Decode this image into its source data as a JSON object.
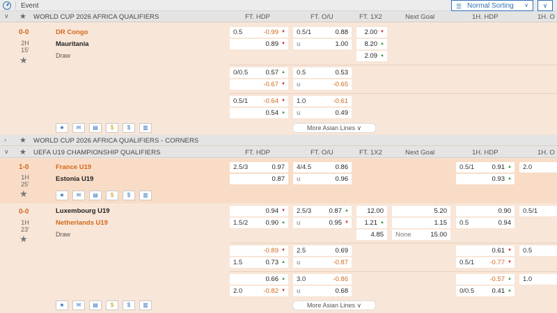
{
  "topbar": {
    "event_label": "Event",
    "sort_label": "Normal Sorting",
    "sort_caret": "∨",
    "collapse": "∨"
  },
  "headers": {
    "ft_hdp": "FT. HDP",
    "ft_ou": "FT. O/U",
    "ft_1x2": "FT. 1X2",
    "next_goal": "Next Goal",
    "h1_hdp": "1H. HDP",
    "h1_ou": "1H. O"
  },
  "leagues": [
    {
      "name": "WORLD CUP 2026 AFRICA QUALIFIERS",
      "chev": "∨"
    },
    {
      "name": "WORLD CUP 2026 AFRICA QUALIFIERS - CORNERS",
      "chev": "›"
    },
    {
      "name": "UEFA U19 CHAMPIONSHIP QUALIFIERS",
      "chev": "∨"
    }
  ],
  "m1": {
    "score": "0-0",
    "half": "2H",
    "minute": "15'",
    "home": "DR Congo",
    "away": "Mauritania",
    "draw": "Draw",
    "r1": {
      "hdp_l": "0.5",
      "hdp_home": "-0.99",
      "hdp_away": "0.89",
      "ou_l": "0.5/1",
      "ou_over": "0.88",
      "ou_u": "u",
      "ou_under": "1.00",
      "x_home": "2.00",
      "x_away": "8.20",
      "x_draw": "2.09"
    },
    "r2": {
      "hdp_l": "0/0.5",
      "hdp_home": "0.57",
      "hdp_away": "-0.67",
      "ou_l": "0.5",
      "ou_over": "0.53",
      "ou_u": "u",
      "ou_under": "-0.65"
    },
    "r3": {
      "hdp_l": "0.5/1",
      "hdp_home": "-0.64",
      "hdp_away": "0.54",
      "ou_l": "1.0",
      "ou_over": "-0.61",
      "ou_u": "u",
      "ou_under": "0.49"
    },
    "more": "More Asian Lines ∨"
  },
  "m2": {
    "score": "1-0",
    "half": "1H",
    "minute": "25'",
    "home": "France U19",
    "away": "Estonia U19",
    "hdp_l": "2.5/3",
    "hdp_home": "0.97",
    "hdp_away": "0.87",
    "ou_l": "4/4.5",
    "ou_over": "0.86",
    "ou_u": "u",
    "ou_under": "0.96",
    "h1_l": "0.5/1",
    "h1_home": "0.91",
    "h1_away": "0.93",
    "h1ou_l": "2.0"
  },
  "m3": {
    "score": "0-0",
    "half": "1H",
    "minute": "23'",
    "home": "Luxembourg U19",
    "away": "Netherlands U19",
    "draw": "Draw",
    "r1": {
      "hdp_home": "0.94",
      "hdp_l2": "1.5/2",
      "hdp_away": "0.90",
      "ou_l": "2.5/3",
      "ou_over": "0.87",
      "ou_u": "u",
      "ou_under": "0.95",
      "x_home": "12.00",
      "x_away": "1.21",
      "x_draw": "4.85",
      "ng_home": "5.20",
      "ng_away": "1.15",
      "ng_none_l": "None",
      "ng_none": "15.00",
      "h1_home": "0.90",
      "h1_l2": "0.5",
      "h1_away": "0.94",
      "h1ou_l": "0.5/1"
    },
    "r2": {
      "hdp_home": "-0.89",
      "hdp_l2": "1.5",
      "hdp_away": "0.73",
      "ou_l": "2.5",
      "ou_over": "0.69",
      "ou_u": "u",
      "ou_under": "-0.87",
      "h1_home": "0.61",
      "h1_l2": "0.5/1",
      "h1_away": "-0.77",
      "h1ou_l": "0.5"
    },
    "r3": {
      "hdp_home": "0.66",
      "hdp_l2": "2.0",
      "hdp_away": "-0.82",
      "ou_l": "3.0",
      "ou_over": "-0.86",
      "ou_u": "u",
      "ou_under": "0.68",
      "h1_home": "-0.57",
      "h1_l2": "0/0.5",
      "h1_away": "0.41",
      "h1ou_l": "1.0"
    },
    "more": "More Asian Lines ∨"
  },
  "icons": {
    "star": "★",
    "mail": "✉",
    "stats": "▤",
    "coin": "$",
    "dollar": "$",
    "bars": "▥",
    "arrow_down": "▼",
    "arrow_up": "▲"
  },
  "colors": {
    "accent": "#2f6fb8",
    "negative": "#d2691e",
    "down": "#cc2222",
    "up": "#2f9a3a"
  }
}
